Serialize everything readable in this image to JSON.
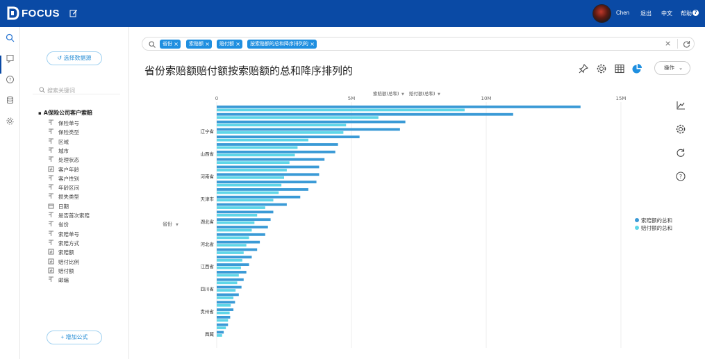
{
  "app": {
    "logo_text": "FOCUS",
    "user_name": "Chen",
    "logout": "退出",
    "language": "中文",
    "help": "帮助",
    "help_icon": "?"
  },
  "sidebar": {
    "select_source": "选择数据源",
    "select_source_icon": "↺",
    "search_placeholder": "搜索关键词",
    "tree_title": "A保险公司客户索赔",
    "fields": [
      {
        "label": "保险单号",
        "type": "text"
      },
      {
        "label": "保险类型",
        "type": "text"
      },
      {
        "label": "区域",
        "type": "text"
      },
      {
        "label": "城市",
        "type": "text"
      },
      {
        "label": "处理状态",
        "type": "text"
      },
      {
        "label": "客户年龄",
        "type": "number"
      },
      {
        "label": "客户性别",
        "type": "text"
      },
      {
        "label": "年龄区间",
        "type": "text"
      },
      {
        "label": "损失类型",
        "type": "text"
      },
      {
        "label": "日期",
        "type": "date"
      },
      {
        "label": "是否首次索赔",
        "type": "text"
      },
      {
        "label": "省份",
        "type": "text"
      },
      {
        "label": "索赔单号",
        "type": "text"
      },
      {
        "label": "索赔方式",
        "type": "text"
      },
      {
        "label": "索赔额",
        "type": "number"
      },
      {
        "label": "赔付比例",
        "type": "number"
      },
      {
        "label": "赔付额",
        "type": "number"
      },
      {
        "label": "邮编",
        "type": "text"
      }
    ],
    "add_formula": "增加公式",
    "add_formula_icon": "+"
  },
  "search": {
    "chips": [
      {
        "label": "省份"
      },
      {
        "label": "索赔额"
      },
      {
        "label": "赔付额"
      },
      {
        "label": "按索赔额的总和降序排列的"
      }
    ],
    "clear": "×",
    "refresh_icon": "refresh-icon"
  },
  "main": {
    "title": "省份索赔额赔付额按索赔额的总和降序排列的",
    "operate_button": "操作"
  },
  "chart_data": {
    "type": "bar",
    "orientation": "horizontal",
    "x_axis_label": "省份",
    "x_axis_label_caret": "▼",
    "measure_headers": [
      "索赔额(总和)",
      "赔付额(总和)"
    ],
    "measure_header_caret": "▼",
    "xlim": [
      0,
      15000000
    ],
    "ticks": [
      {
        "value": 0,
        "label": "0"
      },
      {
        "value": 5000000,
        "label": "5M"
      },
      {
        "value": 10000000,
        "label": "10M"
      },
      {
        "value": 15000000,
        "label": "15M"
      }
    ],
    "legend_position": "right",
    "grid": true,
    "categories": [
      "",
      "",
      "",
      "辽宁省",
      "",
      "",
      "山西省",
      "",
      "",
      "河南省",
      "",
      "",
      "天津市",
      "",
      "",
      "湖北省",
      "",
      "",
      "河北省",
      "",
      "",
      "江西省",
      "",
      "",
      "四川省",
      "",
      "",
      "贵州省",
      "",
      "",
      "西藏"
    ],
    "series": [
      {
        "name": "索赔额的总和",
        "color": "#3a9ad6",
        "values": [
          13500000,
          11000000,
          7000000,
          6800000,
          5300000,
          4500000,
          4400000,
          4000000,
          3800000,
          3800000,
          3700000,
          3400000,
          3100000,
          2600000,
          2100000,
          2000000,
          1900000,
          1800000,
          1600000,
          1500000,
          1300000,
          1200000,
          1100000,
          1000000,
          920000,
          820000,
          680000,
          620000,
          500000,
          420000,
          260000,
          150000
        ]
      },
      {
        "name": "赔付额的总和",
        "color": "#5ed6e8",
        "values": [
          9200000,
          6000000,
          4800000,
          4700000,
          3400000,
          3000000,
          2900000,
          2700000,
          2600000,
          2500000,
          2400000,
          2300000,
          2100000,
          1800000,
          1500000,
          1400000,
          1300000,
          1200000,
          1100000,
          1000000,
          950000,
          900000,
          820000,
          760000,
          700000,
          620000,
          520000,
          480000,
          420000,
          340000,
          200000,
          120000
        ]
      }
    ]
  }
}
